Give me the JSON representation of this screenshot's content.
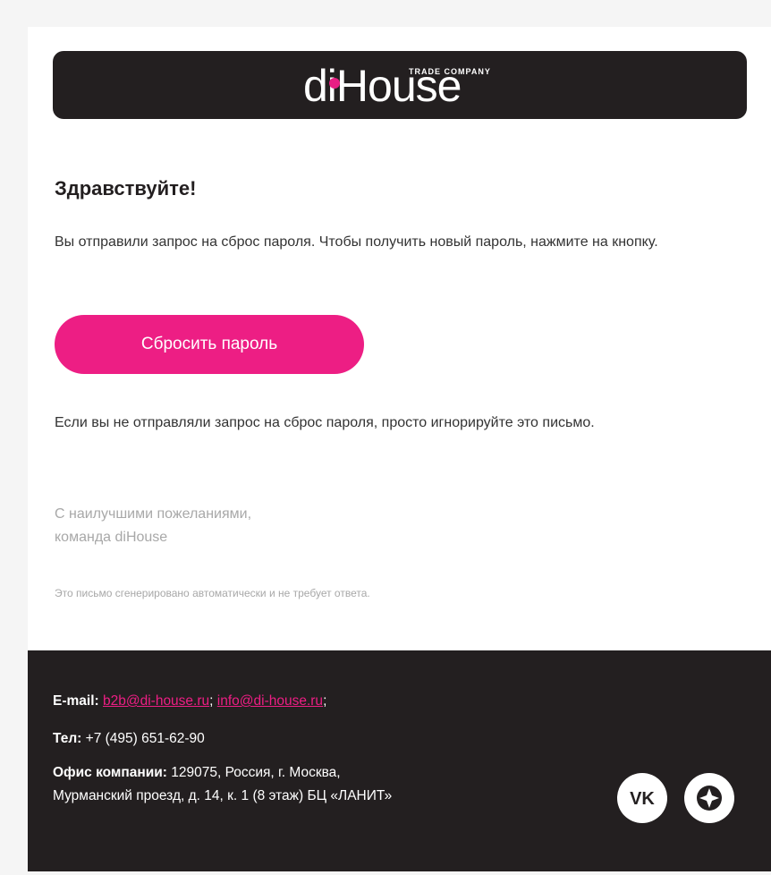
{
  "header": {
    "logo_text": "diHouse",
    "logo_tagline": "TRADE COMPANY"
  },
  "body": {
    "greeting": "Здравствуйте!",
    "intro": "Вы отправили запрос на сброс пароля. Чтобы получить новый пароль, нажмите на кнопку.",
    "button_label": "Сбросить пароль",
    "ignore_note": "Если вы не отправляли запрос на сброс пароля, просто игнорируйте это письмо.",
    "signature_line1": "С наилучшими пожеланиями,",
    "signature_line2": "команда diHouse",
    "auto_note": "Это письмо сгенерировано автоматически и не требует ответа."
  },
  "footer": {
    "email_label": "E-mail:",
    "email_1": "b2b@di-house.ru",
    "email_sep": ";",
    "email_2": "info@di-house.ru",
    "email_end": ";",
    "tel_label": "Тел:",
    "tel_value": "+7 (495) 651-62-90",
    "office_label": "Офис компании:",
    "office_line1": "129075, Россия, г. Москва,",
    "office_line2": "Мурманский проезд, д. 14, к. 1 (8 этаж) БЦ «ЛАНИТ»",
    "social": [
      {
        "icon": "vk-icon",
        "text": "VK"
      },
      {
        "icon": "compass-icon"
      }
    ]
  },
  "colors": {
    "accent": "#ed1e84",
    "dark": "#231f20",
    "muted": "#a8a8a8"
  }
}
